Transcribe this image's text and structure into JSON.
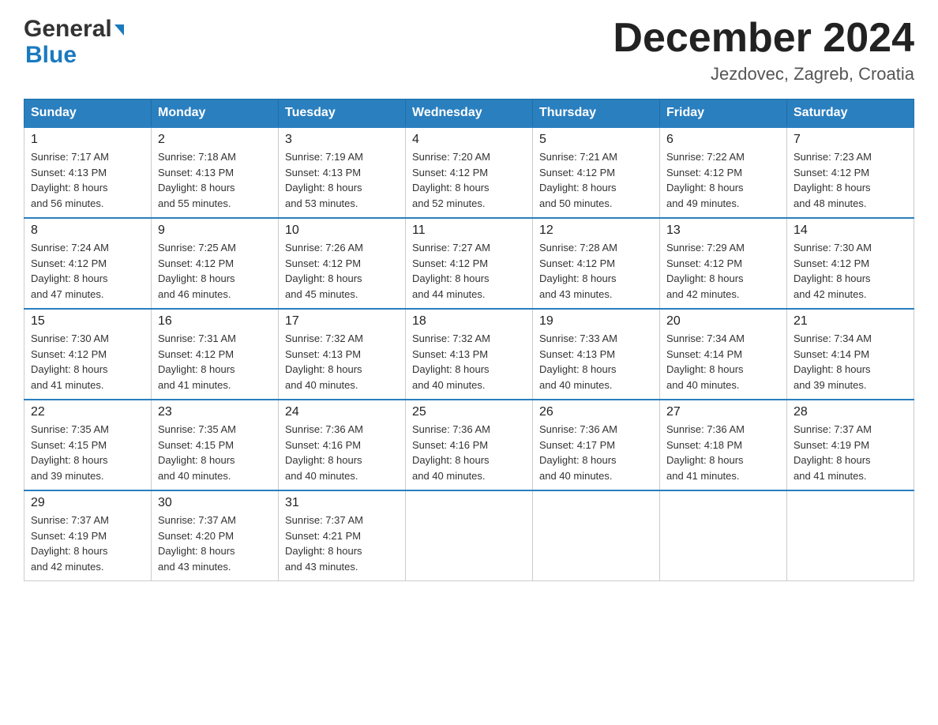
{
  "header": {
    "logo_line1": "General",
    "logo_line2": "Blue",
    "month_title": "December 2024",
    "location": "Jezdovec, Zagreb, Croatia"
  },
  "days_of_week": [
    "Sunday",
    "Monday",
    "Tuesday",
    "Wednesday",
    "Thursday",
    "Friday",
    "Saturday"
  ],
  "weeks": [
    [
      {
        "day": "1",
        "sunrise": "7:17 AM",
        "sunset": "4:13 PM",
        "daylight": "8 hours and 56 minutes."
      },
      {
        "day": "2",
        "sunrise": "7:18 AM",
        "sunset": "4:13 PM",
        "daylight": "8 hours and 55 minutes."
      },
      {
        "day": "3",
        "sunrise": "7:19 AM",
        "sunset": "4:13 PM",
        "daylight": "8 hours and 53 minutes."
      },
      {
        "day": "4",
        "sunrise": "7:20 AM",
        "sunset": "4:12 PM",
        "daylight": "8 hours and 52 minutes."
      },
      {
        "day": "5",
        "sunrise": "7:21 AM",
        "sunset": "4:12 PM",
        "daylight": "8 hours and 50 minutes."
      },
      {
        "day": "6",
        "sunrise": "7:22 AM",
        "sunset": "4:12 PM",
        "daylight": "8 hours and 49 minutes."
      },
      {
        "day": "7",
        "sunrise": "7:23 AM",
        "sunset": "4:12 PM",
        "daylight": "8 hours and 48 minutes."
      }
    ],
    [
      {
        "day": "8",
        "sunrise": "7:24 AM",
        "sunset": "4:12 PM",
        "daylight": "8 hours and 47 minutes."
      },
      {
        "day": "9",
        "sunrise": "7:25 AM",
        "sunset": "4:12 PM",
        "daylight": "8 hours and 46 minutes."
      },
      {
        "day": "10",
        "sunrise": "7:26 AM",
        "sunset": "4:12 PM",
        "daylight": "8 hours and 45 minutes."
      },
      {
        "day": "11",
        "sunrise": "7:27 AM",
        "sunset": "4:12 PM",
        "daylight": "8 hours and 44 minutes."
      },
      {
        "day": "12",
        "sunrise": "7:28 AM",
        "sunset": "4:12 PM",
        "daylight": "8 hours and 43 minutes."
      },
      {
        "day": "13",
        "sunrise": "7:29 AM",
        "sunset": "4:12 PM",
        "daylight": "8 hours and 42 minutes."
      },
      {
        "day": "14",
        "sunrise": "7:30 AM",
        "sunset": "4:12 PM",
        "daylight": "8 hours and 42 minutes."
      }
    ],
    [
      {
        "day": "15",
        "sunrise": "7:30 AM",
        "sunset": "4:12 PM",
        "daylight": "8 hours and 41 minutes."
      },
      {
        "day": "16",
        "sunrise": "7:31 AM",
        "sunset": "4:12 PM",
        "daylight": "8 hours and 41 minutes."
      },
      {
        "day": "17",
        "sunrise": "7:32 AM",
        "sunset": "4:13 PM",
        "daylight": "8 hours and 40 minutes."
      },
      {
        "day": "18",
        "sunrise": "7:32 AM",
        "sunset": "4:13 PM",
        "daylight": "8 hours and 40 minutes."
      },
      {
        "day": "19",
        "sunrise": "7:33 AM",
        "sunset": "4:13 PM",
        "daylight": "8 hours and 40 minutes."
      },
      {
        "day": "20",
        "sunrise": "7:34 AM",
        "sunset": "4:14 PM",
        "daylight": "8 hours and 40 minutes."
      },
      {
        "day": "21",
        "sunrise": "7:34 AM",
        "sunset": "4:14 PM",
        "daylight": "8 hours and 39 minutes."
      }
    ],
    [
      {
        "day": "22",
        "sunrise": "7:35 AM",
        "sunset": "4:15 PM",
        "daylight": "8 hours and 39 minutes."
      },
      {
        "day": "23",
        "sunrise": "7:35 AM",
        "sunset": "4:15 PM",
        "daylight": "8 hours and 40 minutes."
      },
      {
        "day": "24",
        "sunrise": "7:36 AM",
        "sunset": "4:16 PM",
        "daylight": "8 hours and 40 minutes."
      },
      {
        "day": "25",
        "sunrise": "7:36 AM",
        "sunset": "4:16 PM",
        "daylight": "8 hours and 40 minutes."
      },
      {
        "day": "26",
        "sunrise": "7:36 AM",
        "sunset": "4:17 PM",
        "daylight": "8 hours and 40 minutes."
      },
      {
        "day": "27",
        "sunrise": "7:36 AM",
        "sunset": "4:18 PM",
        "daylight": "8 hours and 41 minutes."
      },
      {
        "day": "28",
        "sunrise": "7:37 AM",
        "sunset": "4:19 PM",
        "daylight": "8 hours and 41 minutes."
      }
    ],
    [
      {
        "day": "29",
        "sunrise": "7:37 AM",
        "sunset": "4:19 PM",
        "daylight": "8 hours and 42 minutes."
      },
      {
        "day": "30",
        "sunrise": "7:37 AM",
        "sunset": "4:20 PM",
        "daylight": "8 hours and 43 minutes."
      },
      {
        "day": "31",
        "sunrise": "7:37 AM",
        "sunset": "4:21 PM",
        "daylight": "8 hours and 43 minutes."
      },
      null,
      null,
      null,
      null
    ]
  ],
  "labels": {
    "sunrise": "Sunrise:",
    "sunset": "Sunset:",
    "daylight": "Daylight:"
  }
}
